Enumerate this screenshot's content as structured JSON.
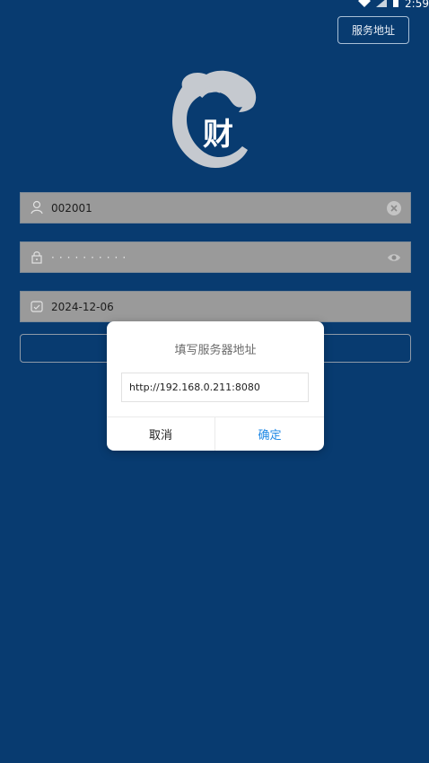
{
  "status": {
    "time": "2:59",
    "icons": [
      "wifi-icon",
      "signal-icon",
      "battery-icon"
    ]
  },
  "header": {
    "server_button_label": "服务地址"
  },
  "logo": {
    "text": "财"
  },
  "login_form": {
    "username": {
      "value": "002001",
      "icon": "user-icon",
      "clear_icon": "clear-icon"
    },
    "password": {
      "value": "··········",
      "icon": "lock-icon",
      "toggle_icon": "eye-icon"
    },
    "date": {
      "value": "2024-12-06",
      "icon": "calendar-icon"
    }
  },
  "dialog": {
    "title": "填写服务器地址",
    "input_value": "http://192.168.0.211:8080",
    "cancel_label": "取消",
    "confirm_label": "确定"
  },
  "colors": {
    "background": "#083b70",
    "field_bg": "#9a9a9a",
    "accent": "#1e88e5"
  }
}
